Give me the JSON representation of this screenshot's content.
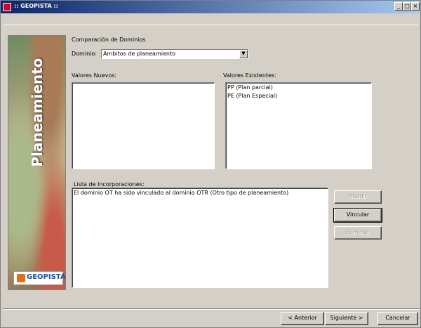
{
  "window": {
    "title": ":: GEOPISTA ::",
    "minimize_glyph": "_",
    "maximize_glyph": "□",
    "close_glyph": "×"
  },
  "sidebar": {
    "label": "Planeamiento",
    "logo_text": "GEOPISTA"
  },
  "section_title": "Comparación de Dominios",
  "dominio": {
    "label": "Dominio:",
    "selected": "Ambitos de planeamiento",
    "dropdown_glyph": "▼"
  },
  "valores_nuevos": {
    "label": "Valores Nuevos:",
    "items": []
  },
  "valores_existentes": {
    "label": "Valores Existentes:",
    "items": [
      "PP (Plan parcial)",
      "PE (Plan Especial)"
    ]
  },
  "incorporaciones": {
    "label": "Lista de Incorporaciones:",
    "items": [
      "El dominio OT ha sido vinculado al dominio OTR (Otro tipo de planeamiento)"
    ]
  },
  "buttons": {
    "anadir": "Añadir",
    "vincular": "Vincular",
    "eliminar": "Eliminar",
    "anterior": "< Anterior",
    "siguiente": "Siguiente >",
    "cancelar": "Cancelar"
  }
}
